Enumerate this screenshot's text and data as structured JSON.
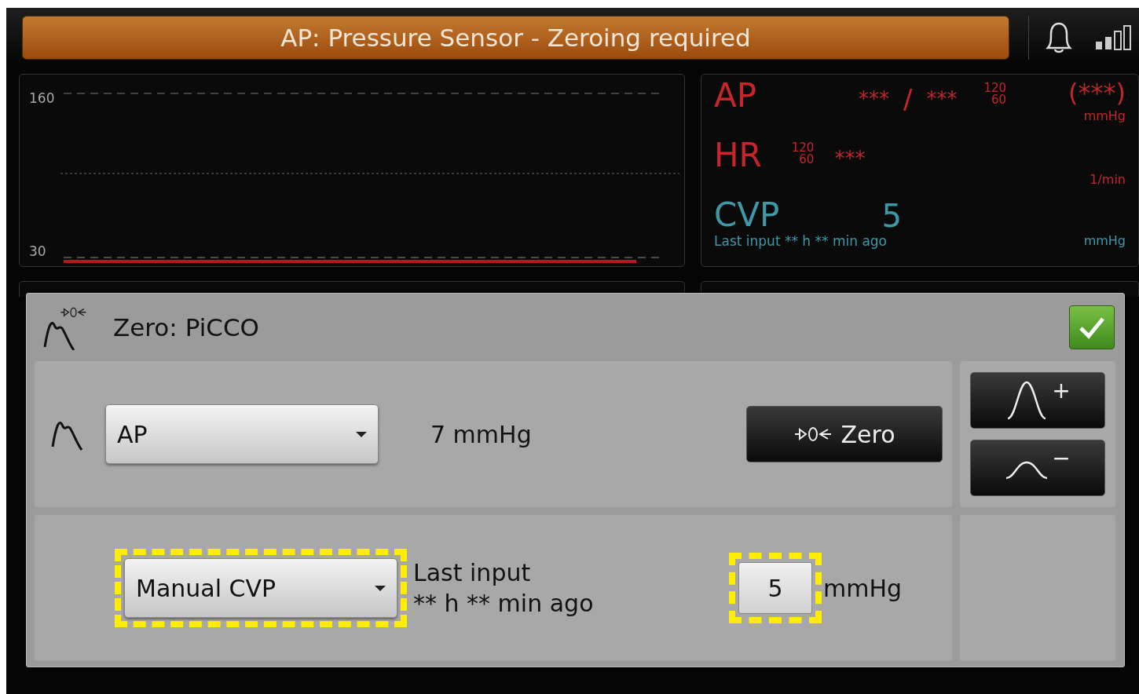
{
  "alarm_banner": {
    "text": "AP: Pressure Sensor - Zeroing required"
  },
  "waveform": {
    "scale_max": "160",
    "scale_min": "30"
  },
  "vitals": [
    {
      "kind": "pressure",
      "label": "AP",
      "color": "#c4262b",
      "systolic": "***",
      "separator": "/",
      "diastolic": "***",
      "limit_high": "120",
      "limit_low": "60",
      "mean": "(***)",
      "unit": "mmHg"
    },
    {
      "kind": "rate",
      "label": "HR",
      "color": "#c4262b",
      "limit_high": "120",
      "limit_low": "60",
      "value": "***",
      "unit": "1/min"
    },
    {
      "kind": "manual",
      "label": "CVP",
      "color": "#3f98a8",
      "value": "5",
      "note": "Last input ** h ** min ago",
      "unit": "mmHg"
    }
  ],
  "dialog": {
    "title": "Zero: PiCCO",
    "rows": [
      {
        "kind": "measured",
        "select": "AP",
        "reading": "7 mmHg",
        "button": "Zero",
        "highlighted": false
      },
      {
        "kind": "manual",
        "select": "Manual CVP",
        "note_line1": "Last input",
        "note_line2": "** h ** min ago",
        "value": "5",
        "unit": "mmHg",
        "highlighted": true
      }
    ],
    "scale_buttons": [
      {
        "sign": "+"
      },
      {
        "sign": "−"
      }
    ]
  }
}
